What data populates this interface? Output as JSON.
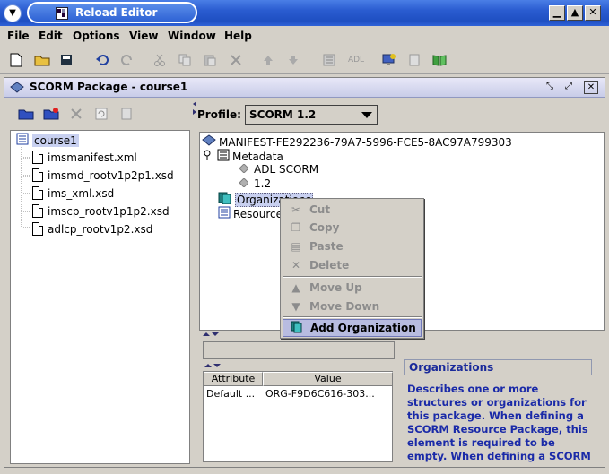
{
  "window": {
    "title": "Reload Editor"
  },
  "menubar": [
    "File",
    "Edit",
    "Options",
    "View",
    "Window",
    "Help"
  ],
  "toolbar": {
    "adl_label": "ADL"
  },
  "frame": {
    "title": "SCORM Package - course1"
  },
  "left_tree": {
    "root": "course1",
    "files": [
      "imsmanifest.xml",
      "imsmd_rootv1p2p1.xsd",
      "ims_xml.xsd",
      "imscp_rootv1p1p2.xsd",
      "adlcp_rootv1p2.xsd"
    ]
  },
  "profile": {
    "label": "Profile:",
    "value": "SCORM 1.2"
  },
  "manifest_tree": {
    "root": "MANIFEST-FE292236-79A7-5996-FCE5-8AC97A799303",
    "metadata": "Metadata",
    "schema": "ADL SCORM",
    "schema_version": "1.2",
    "organizations": "Organizations",
    "resources": "Resources"
  },
  "context_menu": {
    "cut": "Cut",
    "copy": "Copy",
    "paste": "Paste",
    "delete": "Delete",
    "move_up": "Move Up",
    "move_down": "Move Down",
    "add_organization": "Add Organization"
  },
  "attributes": {
    "headers": [
      "Attribute",
      "Value"
    ],
    "row": [
      "Default ...",
      "ORG-F9D6C616-303..."
    ]
  },
  "help": {
    "title": "Organizations",
    "lines": [
      "Describes one or more",
      "structures or organizations for",
      "this package. When defining a",
      "SCORM Resource Package, this",
      "element is required to be",
      "empty. When defining a SCORM"
    ]
  }
}
